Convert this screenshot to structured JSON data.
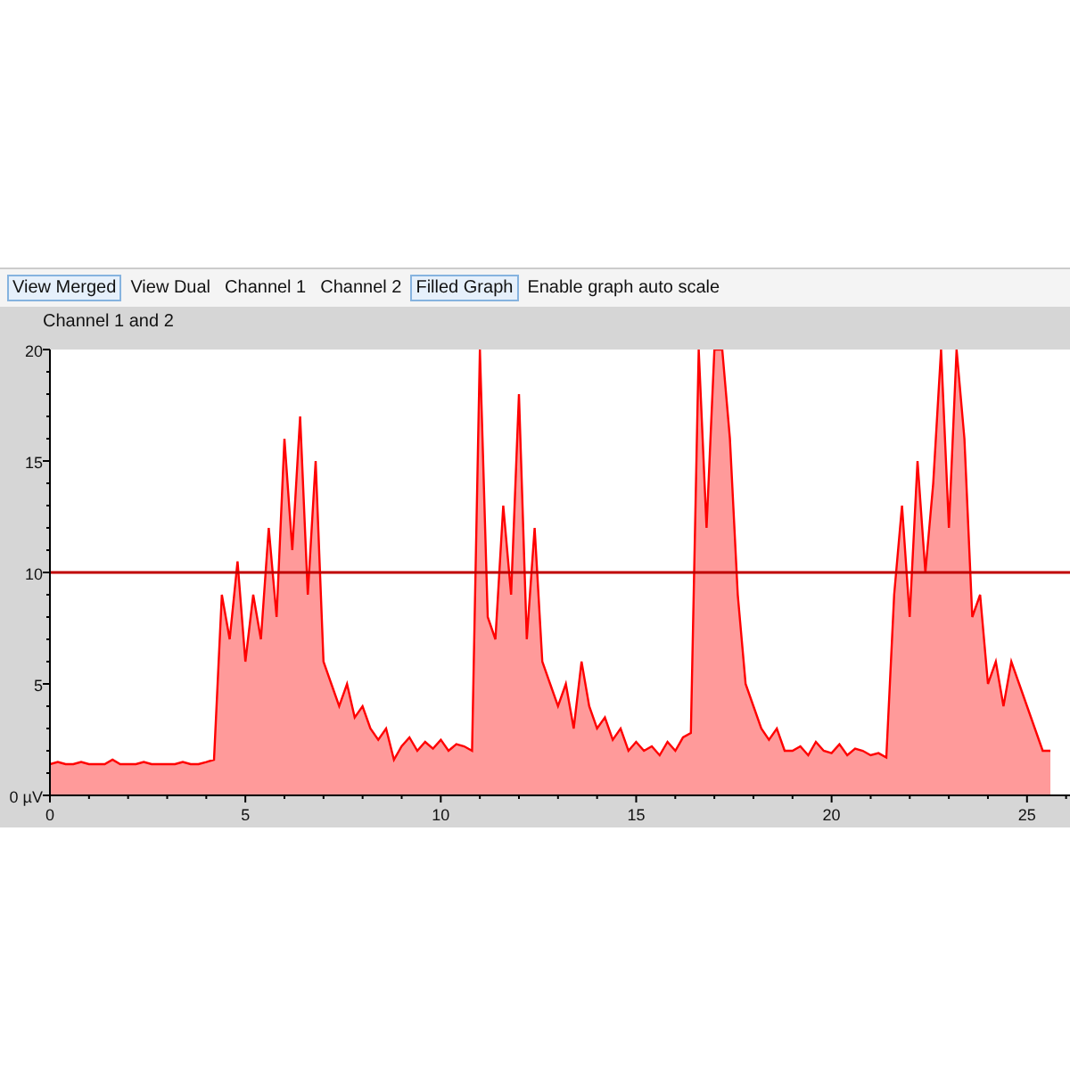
{
  "toolbar": [
    {
      "label": "View Merged",
      "selected": true
    },
    {
      "label": "View Dual",
      "selected": false
    },
    {
      "label": "Channel 1",
      "selected": false
    },
    {
      "label": "Channel 2",
      "selected": false
    },
    {
      "label": "Filled Graph",
      "selected": true
    },
    {
      "label": "Enable graph auto scale",
      "selected": false
    }
  ],
  "chart_data": {
    "type": "area",
    "title": "Channel 1 and 2",
    "xlim": [
      0,
      26.1
    ],
    "ylim": [
      0,
      20
    ],
    "xticks": [
      0,
      5,
      10,
      15,
      20,
      25
    ],
    "yticks": [
      {
        "value": 0,
        "label": "0 µV"
      },
      5,
      10,
      15,
      20
    ],
    "ref_lines": [
      {
        "axis": "y",
        "value": 10,
        "color": "#c00000"
      }
    ],
    "x": [
      0,
      0.2,
      0.4,
      0.6,
      0.8,
      1,
      1.2,
      1.4,
      1.6,
      1.8,
      2,
      2.2,
      2.4,
      2.6,
      2.8,
      3,
      3.2,
      3.4,
      3.6,
      3.8,
      4,
      4.2,
      4.4,
      4.6,
      4.8,
      5,
      5.2,
      5.4,
      5.6,
      5.8,
      6,
      6.2,
      6.4,
      6.6,
      6.8,
      7,
      7.2,
      7.4,
      7.6,
      7.8,
      8,
      8.2,
      8.4,
      8.6,
      8.8,
      9,
      9.2,
      9.4,
      9.6,
      9.8,
      10,
      10.2,
      10.4,
      10.6,
      10.8,
      11,
      11.2,
      11.4,
      11.6,
      11.8,
      12,
      12.2,
      12.4,
      12.6,
      12.8,
      13,
      13.2,
      13.4,
      13.6,
      13.8,
      14,
      14.2,
      14.4,
      14.6,
      14.8,
      15,
      15.2,
      15.4,
      15.6,
      15.8,
      16,
      16.2,
      16.4,
      16.6,
      16.8,
      17,
      17.2,
      17.4,
      17.6,
      17.8,
      18,
      18.2,
      18.4,
      18.6,
      18.8,
      19,
      19.2,
      19.4,
      19.6,
      19.8,
      20,
      20.2,
      20.4,
      20.6,
      20.8,
      21,
      21.2,
      21.4,
      21.6,
      21.8,
      22,
      22.2,
      22.4,
      22.6,
      22.8,
      23,
      23.2,
      23.4,
      23.6,
      23.8,
      24,
      24.2,
      24.4,
      24.6,
      24.8,
      25,
      25.2,
      25.4,
      25.6
    ],
    "series": [
      {
        "color": "#ff0000",
        "values": [
          1.4,
          1.5,
          1.4,
          1.4,
          1.5,
          1.4,
          1.4,
          1.4,
          1.6,
          1.4,
          1.4,
          1.4,
          1.5,
          1.4,
          1.4,
          1.4,
          1.4,
          1.5,
          1.4,
          1.4,
          1.5,
          1.6,
          9,
          7,
          10.5,
          6,
          9,
          7,
          12,
          8,
          16,
          11,
          17,
          9,
          15,
          6,
          5,
          4,
          5,
          3.5,
          4,
          3,
          2.5,
          3,
          1.6,
          2.2,
          2.6,
          2,
          2.4,
          2.1,
          2.5,
          2,
          2.3,
          2.2,
          2,
          20,
          8,
          7,
          13,
          9,
          18,
          7,
          12,
          6,
          5,
          4,
          5,
          3,
          6,
          4,
          3,
          3.5,
          2.5,
          3,
          2,
          2.4,
          2,
          2.2,
          1.8,
          2.4,
          2,
          2.6,
          2.8,
          20,
          12,
          20,
          20,
          16,
          9,
          5,
          4,
          3,
          2.5,
          3,
          2,
          2,
          2.2,
          1.8,
          2.4,
          2,
          1.9,
          2.3,
          1.8,
          2.1,
          2,
          1.8,
          1.9,
          1.7,
          9,
          13,
          8,
          15,
          10,
          14,
          20,
          12,
          20,
          16,
          8,
          9,
          5,
          6,
          4,
          6,
          5,
          4,
          3,
          2,
          2
        ]
      }
    ]
  }
}
